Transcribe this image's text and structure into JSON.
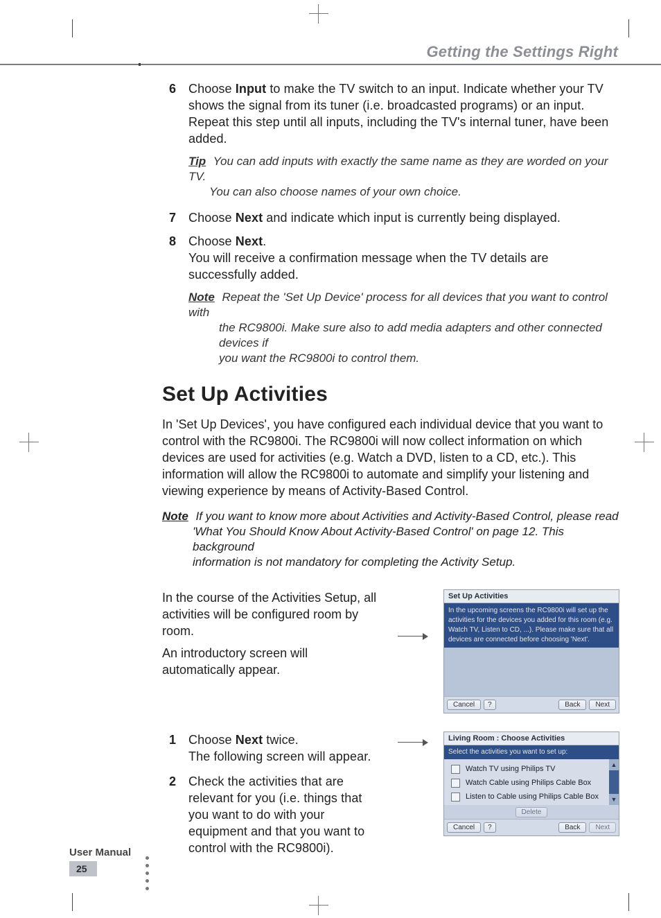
{
  "header": {
    "title": "Getting the Settings Right"
  },
  "steps_a": {
    "s6": {
      "num": "6",
      "text_before": "Choose ",
      "bold": "Input",
      "text_after": " to make the TV switch to an input. Indicate whether your TV shows the signal from its tuner (i.e. broadcasted programs) or an input. Repeat this step until all inputs, including the TV's internal tuner, have been added."
    },
    "tip": {
      "label": "Tip",
      "line1": "You can add inputs with exactly the same name as they are worded on your TV.",
      "line2": "You can also choose names of your own choice."
    },
    "s7": {
      "num": "7",
      "text_before": "Choose ",
      "bold": "Next",
      "text_after": " and indicate which input is currently being displayed."
    },
    "s8": {
      "num": "8",
      "text_before": "Choose ",
      "bold": "Next",
      "punct": ".",
      "line2": "You will receive a confirmation message when the TV details are successfully added."
    },
    "note": {
      "label": "Note",
      "line1": "Repeat the 'Set Up Device' process for all devices that you want to control with",
      "line2": "the RC9800i. Make sure also to add media adapters and other connected devices if",
      "line3": "you want the RC9800i to control them."
    }
  },
  "section": {
    "heading": "Set Up Activities",
    "para": "In 'Set Up Devices', you have configured each individual device that you want to control with the RC9800i. The RC9800i will now collect information on which devices are used for activities (e.g. Watch a DVD, listen to a CD, etc.). This information will allow the RC9800i to automate and simplify your listening and viewing experience by means of Activity-Based Control.",
    "note": {
      "label": "Note",
      "line1": "If you want to know more about Activities and Activity-Based Control, please read",
      "line2": "'What You Should Know About Activity-Based Control' on page 12. This background",
      "line3": "information is not mandatory for completing the Activity Setup."
    }
  },
  "row1": {
    "p1": "In the course of the Activities Setup, all activities will be configured room by room.",
    "p2": "An introductory screen will automatically appear."
  },
  "device1": {
    "title": "Set Up Activities",
    "body": "In the upcoming screens the RC9800i will set up the activities for the devices you added for this room (e.g. Watch TV, Listen to CD, ...). Please make sure that all devices are connected before choosing 'Next'.",
    "cancel": "Cancel",
    "help": "?",
    "back": "Back",
    "next": "Next"
  },
  "row2": {
    "s1": {
      "num": "1",
      "text_before": "Choose ",
      "bold": "Next",
      "text_after": " twice.",
      "line2": "The following screen will appear."
    },
    "s2": {
      "num": "2",
      "text": "Check the activities that are relevant for you (i.e. things that you want to do with your equipment and that you want to control with the RC9800i)."
    }
  },
  "device2": {
    "title": "Living Room : Choose Activities",
    "header": "Select the activities you want to set up:",
    "items": [
      "Watch TV using Philips TV",
      "Watch Cable using Philips Cable Box",
      "Listen to Cable using Philips Cable Box"
    ],
    "scroll_up": "▲",
    "scroll_down": "▼",
    "delete": "Delete",
    "cancel": "Cancel",
    "help": "?",
    "back": "Back",
    "next": "Next"
  },
  "footer": {
    "label": "User Manual",
    "page": "25"
  }
}
